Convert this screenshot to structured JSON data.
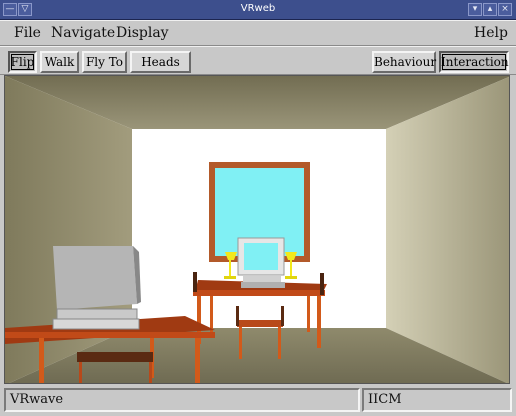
{
  "window": {
    "title": "VRweb"
  },
  "menu": {
    "file": "File",
    "navigate": "Navigate",
    "display": "Display",
    "help": "Help"
  },
  "toolbar": {
    "flip": "Flip",
    "walk": "Walk",
    "fly_to": "Fly To",
    "heads_up": "Heads Up",
    "behaviour": "Behaviour",
    "interaction": "Interaction"
  },
  "status": {
    "left": "VRwave",
    "right": "IICM"
  },
  "colors": {
    "titlebar": "#3d4f8d",
    "wall_back": "#ffffff",
    "window_glass": "#80f0f4",
    "window_frame": "#b35a2a",
    "table": "#a03a12",
    "table_legs": "#d25a1a"
  }
}
